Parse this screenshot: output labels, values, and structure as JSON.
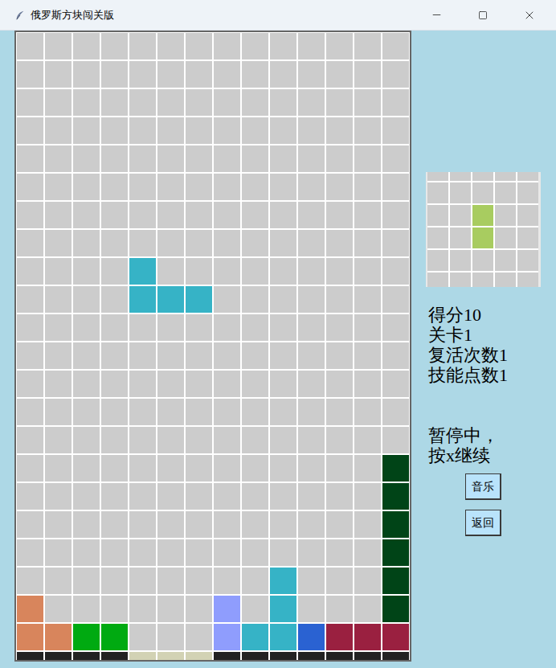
{
  "window": {
    "title": "俄罗斯方块闯关版"
  },
  "palette": {
    "O": "#d8855c",
    "g": "#00aa11",
    "D": "#004417",
    "C": "#36b3c6",
    "L": "#8f9dfd",
    "B": "#2a62d2",
    "R": "#9a2040",
    "K": "#222222",
    "Y": "#d2d2b4",
    "P": "#a8cc60"
  },
  "board": {
    "rows": [
      "..............",
      "..............",
      "..............",
      "..............",
      "..............",
      "..............",
      "..............",
      "..............",
      "....C.........",
      "....CCC.......",
      "..............",
      "..............",
      "..............",
      "..............",
      "..............",
      ".............D",
      ".............D",
      ".............D",
      ".............D",
      ".........C...D",
      "O......L.C...D",
      "OOgg...LCCBRRR",
      "KKKKYYYKKKKKKK"
    ]
  },
  "next_piece": {
    "rows": [
      ".....",
      ".....",
      "..P..",
      "..P..",
      ".....",
      "....."
    ]
  },
  "stats": [
    {
      "label": "得分",
      "value": "10"
    },
    {
      "label": "关卡",
      "value": "1"
    },
    {
      "label": "复活次数",
      "value": "1"
    },
    {
      "label": "技能点数",
      "value": "1"
    }
  ],
  "status": [
    "暂停中，",
    "按x继续"
  ],
  "buttons": [
    "音乐",
    "返回"
  ]
}
